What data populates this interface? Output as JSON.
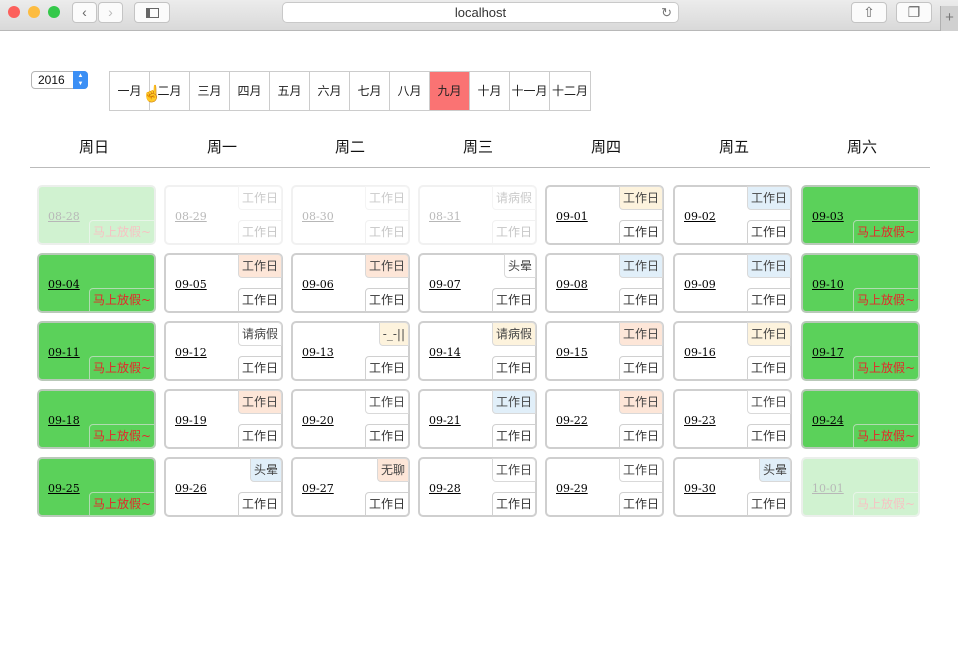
{
  "browser": {
    "url": "localhost",
    "reload_icon": "reload-icon",
    "back_icon": "chevron-left-icon",
    "forward_icon": "chevron-right-icon",
    "sidebar_icon": "sidebar-icon",
    "share_icon": "share-icon",
    "tabs_icon": "tabs-icon",
    "new_tab": "+"
  },
  "year": {
    "value": "2016"
  },
  "months": [
    "一月",
    "二月",
    "三月",
    "四月",
    "五月",
    "六月",
    "七月",
    "八月",
    "九月",
    "十月",
    "十一月",
    "十二月"
  ],
  "selected_month_index": 8,
  "weekdays": [
    "周日",
    "周一",
    "周二",
    "周三",
    "周四",
    "周五",
    "周六"
  ],
  "colors": {
    "weekend": "#5bd15a",
    "selected_month": "#fa7373",
    "holiday_text": "#e6262a"
  },
  "days": [
    {
      "date": "08-28",
      "tag": "",
      "bottom": "马上放假~",
      "kind": "weekend",
      "faded": true,
      "tag_color": ""
    },
    {
      "date": "08-29",
      "tag": "工作日",
      "bottom": "工作日",
      "kind": "work",
      "faded": true,
      "tag_color": "white"
    },
    {
      "date": "08-30",
      "tag": "工作日",
      "bottom": "工作日",
      "kind": "work",
      "faded": true,
      "tag_color": "white"
    },
    {
      "date": "08-31",
      "tag": "请病假",
      "bottom": "工作日",
      "kind": "work",
      "faded": true,
      "tag_color": "white"
    },
    {
      "date": "09-01",
      "tag": "工作日",
      "bottom": "工作日",
      "kind": "work",
      "faded": false,
      "tag_color": "cream"
    },
    {
      "date": "09-02",
      "tag": "工作日",
      "bottom": "工作日",
      "kind": "work",
      "faded": false,
      "tag_color": "blue"
    },
    {
      "date": "09-03",
      "tag": "",
      "bottom": "马上放假~",
      "kind": "weekend",
      "faded": false,
      "tag_color": ""
    },
    {
      "date": "09-04",
      "tag": "",
      "bottom": "马上放假~",
      "kind": "weekend",
      "faded": false,
      "tag_color": ""
    },
    {
      "date": "09-05",
      "tag": "工作日",
      "bottom": "工作日",
      "kind": "work",
      "faded": false,
      "tag_color": "peach"
    },
    {
      "date": "09-06",
      "tag": "工作日",
      "bottom": "工作日",
      "kind": "work",
      "faded": false,
      "tag_color": "peach"
    },
    {
      "date": "09-07",
      "tag": "头晕",
      "bottom": "工作日",
      "kind": "work",
      "faded": false,
      "tag_color": "white"
    },
    {
      "date": "09-08",
      "tag": "工作日",
      "bottom": "工作日",
      "kind": "work",
      "faded": false,
      "tag_color": "blue"
    },
    {
      "date": "09-09",
      "tag": "工作日",
      "bottom": "工作日",
      "kind": "work",
      "faded": false,
      "tag_color": "blue"
    },
    {
      "date": "09-10",
      "tag": "",
      "bottom": "马上放假~",
      "kind": "weekend",
      "faded": false,
      "tag_color": ""
    },
    {
      "date": "09-11",
      "tag": "",
      "bottom": "马上放假~",
      "kind": "weekend",
      "faded": false,
      "tag_color": ""
    },
    {
      "date": "09-12",
      "tag": "请病假",
      "bottom": "工作日",
      "kind": "work",
      "faded": false,
      "tag_color": "white"
    },
    {
      "date": "09-13",
      "tag": "-_-||",
      "bottom": "工作日",
      "kind": "work",
      "faded": false,
      "tag_color": "cream"
    },
    {
      "date": "09-14",
      "tag": "请病假",
      "bottom": "工作日",
      "kind": "work",
      "faded": false,
      "tag_color": "cream"
    },
    {
      "date": "09-15",
      "tag": "工作日",
      "bottom": "工作日",
      "kind": "work",
      "faded": false,
      "tag_color": "peach"
    },
    {
      "date": "09-16",
      "tag": "工作日",
      "bottom": "工作日",
      "kind": "work",
      "faded": false,
      "tag_color": "cream"
    },
    {
      "date": "09-17",
      "tag": "",
      "bottom": "马上放假~",
      "kind": "weekend",
      "faded": false,
      "tag_color": ""
    },
    {
      "date": "09-18",
      "tag": "",
      "bottom": "马上放假~",
      "kind": "weekend",
      "faded": false,
      "tag_color": ""
    },
    {
      "date": "09-19",
      "tag": "工作日",
      "bottom": "工作日",
      "kind": "work",
      "faded": false,
      "tag_color": "peach"
    },
    {
      "date": "09-20",
      "tag": "工作日",
      "bottom": "工作日",
      "kind": "work",
      "faded": false,
      "tag_color": "white"
    },
    {
      "date": "09-21",
      "tag": "工作日",
      "bottom": "工作日",
      "kind": "work",
      "faded": false,
      "tag_color": "blue"
    },
    {
      "date": "09-22",
      "tag": "工作日",
      "bottom": "工作日",
      "kind": "work",
      "faded": false,
      "tag_color": "peach"
    },
    {
      "date": "09-23",
      "tag": "工作日",
      "bottom": "工作日",
      "kind": "work",
      "faded": false,
      "tag_color": "white"
    },
    {
      "date": "09-24",
      "tag": "",
      "bottom": "马上放假~",
      "kind": "weekend",
      "faded": false,
      "tag_color": ""
    },
    {
      "date": "09-25",
      "tag": "",
      "bottom": "马上放假~",
      "kind": "weekend",
      "faded": false,
      "tag_color": ""
    },
    {
      "date": "09-26",
      "tag": "头晕",
      "bottom": "工作日",
      "kind": "work",
      "faded": false,
      "tag_color": "blue"
    },
    {
      "date": "09-27",
      "tag": "无聊",
      "bottom": "工作日",
      "kind": "work",
      "faded": false,
      "tag_color": "peach"
    },
    {
      "date": "09-28",
      "tag": "工作日",
      "bottom": "工作日",
      "kind": "work",
      "faded": false,
      "tag_color": "white"
    },
    {
      "date": "09-29",
      "tag": "工作日",
      "bottom": "工作日",
      "kind": "work",
      "faded": false,
      "tag_color": "white"
    },
    {
      "date": "09-30",
      "tag": "头晕",
      "bottom": "工作日",
      "kind": "work",
      "faded": false,
      "tag_color": "blue"
    },
    {
      "date": "10-01",
      "tag": "",
      "bottom": "马上放假~",
      "kind": "weekend",
      "faded": true,
      "tag_color": ""
    }
  ]
}
